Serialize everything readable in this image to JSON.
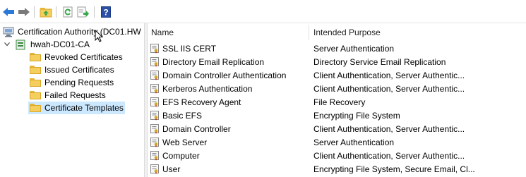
{
  "window": {
    "toolbar": {
      "buttons": [
        {
          "name": "back-icon",
          "color": "#2b79d6"
        },
        {
          "name": "forward-icon",
          "color": "#7a7a7a"
        },
        {
          "name": "up-folder-icon",
          "color": "#d9a628"
        },
        {
          "name": "refresh-icon",
          "color": "#3aa64a"
        },
        {
          "name": "export-list-icon",
          "color": "#3aa64a"
        },
        {
          "name": "help-icon",
          "color": "#2b4fa6"
        }
      ]
    },
    "tree": {
      "root_label": "Certification Authority (DC01.HW",
      "ca_label": "hwah-DC01-CA",
      "items": [
        {
          "label": "Revoked Certificates"
        },
        {
          "label": "Issued Certificates"
        },
        {
          "label": "Pending Requests"
        },
        {
          "label": "Failed Requests"
        },
        {
          "label": "Certificate Templates",
          "selected": true
        }
      ]
    },
    "list": {
      "columns": {
        "name": "Name",
        "purpose": "Intended Purpose"
      },
      "rows": [
        {
          "name": "SSL IIS CERT",
          "purpose": "Server Authentication"
        },
        {
          "name": "Directory Email Replication",
          "purpose": "Directory Service Email Replication"
        },
        {
          "name": "Domain Controller Authentication",
          "purpose": "Client Authentication, Server Authentic..."
        },
        {
          "name": "Kerberos Authentication",
          "purpose": "Client Authentication, Server Authentic..."
        },
        {
          "name": "EFS Recovery Agent",
          "purpose": "File Recovery"
        },
        {
          "name": "Basic EFS",
          "purpose": "Encrypting File System"
        },
        {
          "name": "Domain Controller",
          "purpose": "Client Authentication, Server Authentic..."
        },
        {
          "name": "Web Server",
          "purpose": "Server Authentication"
        },
        {
          "name": "Computer",
          "purpose": "Client Authentication, Server Authentic..."
        },
        {
          "name": "User",
          "purpose": "Encrypting File System, Secure Email, Cl..."
        }
      ]
    },
    "colors": {
      "selection": "#cce8ff",
      "folder": "#f4cf5e"
    }
  }
}
